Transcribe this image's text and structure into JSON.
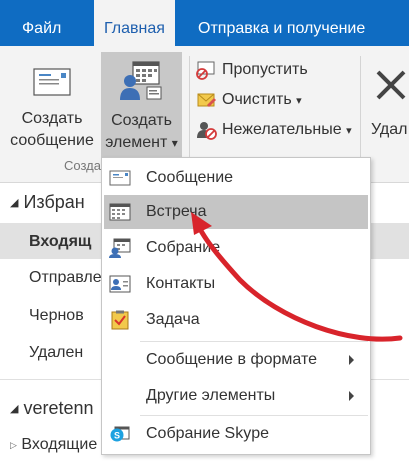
{
  "tabs": [
    {
      "label": "Файл"
    },
    {
      "label": "Главная"
    },
    {
      "label": "Отправка и получение"
    }
  ],
  "ribbon": {
    "new_message": {
      "line1": "Создать",
      "line2": "сообщение"
    },
    "new_item": {
      "line1": "Создать",
      "line2": "элемент",
      "dropdown": "▾"
    },
    "ignore": "Пропустить",
    "clean_up": "Очистить",
    "junk": "Нежелательные",
    "delete_partial": "Удал",
    "group_label": "Созда"
  },
  "folder_pane": {
    "favorites_header": "Избран",
    "items": [
      "Входящ",
      "Отправле",
      "Чернов",
      "Удален"
    ],
    "account": "veretenn",
    "inbox": "Входящие"
  },
  "dropdown_menu": {
    "items": [
      {
        "label": "Сообщение",
        "icon": "envelope-icon"
      },
      {
        "label": "Встреча",
        "icon": "calendar-icon"
      },
      {
        "label": "Собрание",
        "icon": "meeting-icon"
      },
      {
        "label": "Контакты",
        "icon": "contact-card-icon"
      },
      {
        "label": "Задача",
        "icon": "task-clipboard-icon"
      },
      {
        "label": "Сообщение в формате",
        "icon": "",
        "submenu": true
      },
      {
        "label": "Другие элементы",
        "icon": "",
        "submenu": true
      },
      {
        "label": "Собрание Skype",
        "icon": "skype-icon"
      }
    ],
    "highlighted_index": 1
  },
  "colors": {
    "tab_blue": "#0f6cc2",
    "ribbon_bg": "#f3f3f3",
    "highlight": "#c5c5c5",
    "annotation_arrow": "#d8242b"
  }
}
